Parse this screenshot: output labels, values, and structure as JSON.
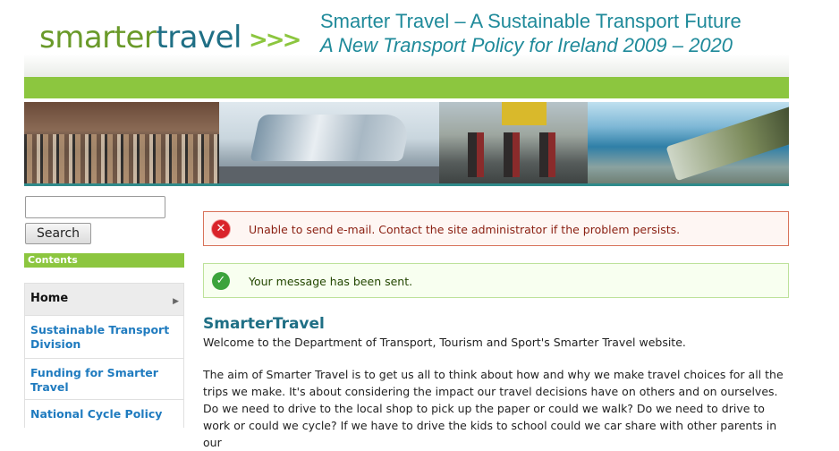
{
  "header": {
    "logo_part1": "smarter",
    "logo_part2": "travel",
    "logo_arrows": ">>>",
    "tagline_line1": "Smarter Travel – A Sustainable Transport Future",
    "tagline_line2": "A New Transport Policy for Ireland 2009 – 2020"
  },
  "search": {
    "input_value": "",
    "button_label": "Search"
  },
  "sidebar": {
    "contents_heading": "Contents",
    "items": [
      {
        "label": "Home",
        "active": true
      },
      {
        "label": "Sustainable Transport Division"
      },
      {
        "label": "Funding for Smarter Travel"
      },
      {
        "label": "National Cycle Policy"
      }
    ]
  },
  "messages": {
    "error": "Unable to send e-mail. Contact the site administrator if the problem persists.",
    "status": "Your message has been sent."
  },
  "main": {
    "title": "SmarterTravel",
    "welcome": "Welcome to the Department of Transport, Tourism and Sport's Smarter Travel website.",
    "para1": "The aim of Smarter Travel is to get us all to think about how and why we make travel choices for all the trips we make.  It's about considering the impact our travel decisions have on others and on ourselves.",
    "para2": "Do we need to drive to the local shop to pick up the paper or could we walk? Do we need to drive to work or could we cycle? If we have to drive the kids to school could we car share with other parents in our"
  },
  "colors": {
    "accent_green": "#8cc63f",
    "logo_teal": "#1f6f85",
    "link_blue": "#1f7bbf",
    "error_red": "#d9232a",
    "ok_green": "#3ca33c"
  },
  "icons": {
    "error": "error-x-icon",
    "status": "checkmark-icon",
    "menu_arrow": "triangle-right-icon"
  }
}
